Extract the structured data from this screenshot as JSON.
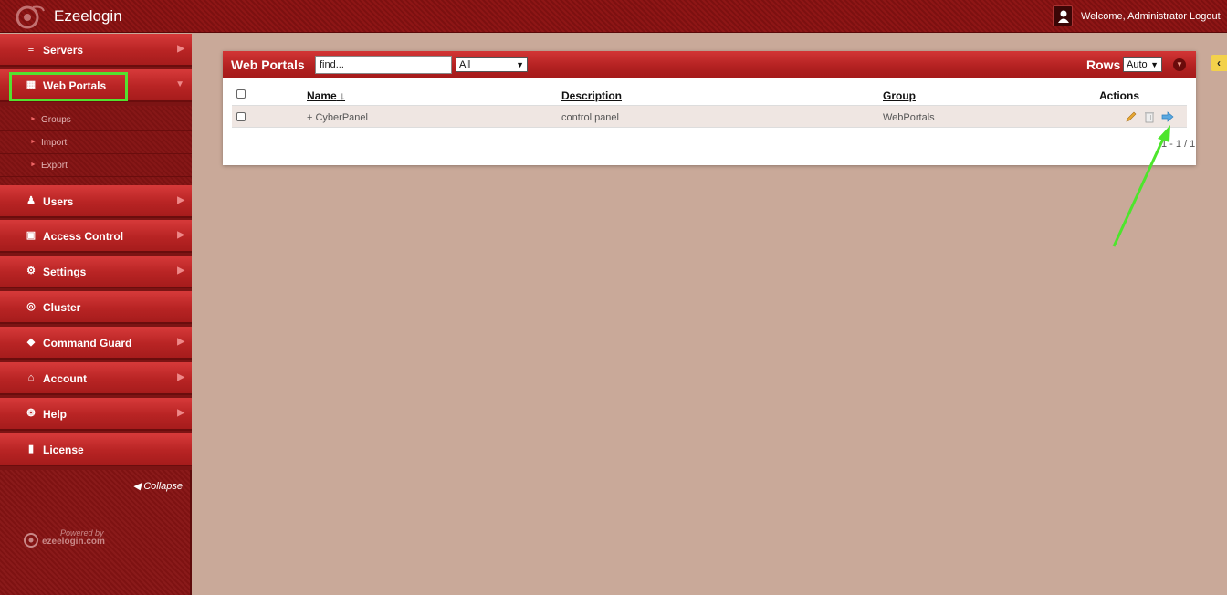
{
  "header": {
    "app_title": "Ezeelogin",
    "welcome_text": "Welcome, Administrator",
    "logout_label": "Logout"
  },
  "sidebar": {
    "items": [
      {
        "label": "Servers",
        "icon": "list-icon"
      },
      {
        "label": "Web Portals",
        "icon": "layout-icon"
      },
      {
        "label": "Users",
        "icon": "users-icon"
      },
      {
        "label": "Access Control",
        "icon": "lock-icon"
      },
      {
        "label": "Settings",
        "icon": "gears-icon"
      },
      {
        "label": "Cluster",
        "icon": "globe-icon"
      },
      {
        "label": "Command Guard",
        "icon": "shield-icon"
      },
      {
        "label": "Account",
        "icon": "home-icon"
      },
      {
        "label": "Help",
        "icon": "lifebuoy-icon"
      },
      {
        "label": "License",
        "icon": "document-icon"
      }
    ],
    "subitems": [
      {
        "label": "Groups"
      },
      {
        "label": "Import"
      },
      {
        "label": "Export"
      }
    ],
    "collapse_label": "Collapse",
    "powered_by": "Powered by",
    "powered_brand": "ezeelogin.com"
  },
  "panel": {
    "title": "Web Portals",
    "search_placeholder": "find...",
    "group_filter": "All",
    "rows_label": "Rows",
    "rows_value": "Auto"
  },
  "table": {
    "columns": [
      "Name",
      "Description",
      "Group",
      "Actions"
    ],
    "sort_indicator": "↓",
    "rows": [
      {
        "name": "+ CyberPanel",
        "description": "control panel",
        "group": "WebPortals"
      }
    ],
    "pagination": "1 - 1 / 1"
  },
  "colors": {
    "brand_red": "#b82424",
    "highlight_green": "#54e12f"
  }
}
